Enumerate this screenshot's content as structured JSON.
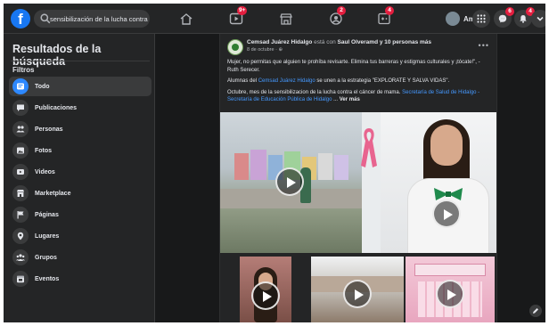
{
  "header": {
    "logo": "f",
    "search_value": "sensibilización de la lucha contra e",
    "nav": [
      {
        "name": "home-icon"
      },
      {
        "name": "watch-icon",
        "badge": "9+"
      },
      {
        "name": "marketplace-icon"
      },
      {
        "name": "groups-icon",
        "badge": "2"
      },
      {
        "name": "gaming-icon",
        "badge": "4"
      }
    ],
    "profile_name": "Ami",
    "actions": [
      {
        "name": "menu-grid-icon"
      },
      {
        "name": "messenger-icon",
        "badge": "6"
      },
      {
        "name": "notifications-bell-icon",
        "badge": "4"
      },
      {
        "name": "account-chevron-icon"
      }
    ]
  },
  "sidebar": {
    "title": "Resultados de la búsqueda",
    "filters_label": "Filtros",
    "items": [
      {
        "label": "Todo",
        "icon": "all-results-icon",
        "active": true
      },
      {
        "label": "Publicaciones",
        "icon": "posts-icon"
      },
      {
        "label": "Personas",
        "icon": "people-icon"
      },
      {
        "label": "Fotos",
        "icon": "photos-icon"
      },
      {
        "label": "Videos",
        "icon": "videos-icon"
      },
      {
        "label": "Marketplace",
        "icon": "marketplace-icon"
      },
      {
        "label": "Páginas",
        "icon": "pages-flag-icon"
      },
      {
        "label": "Lugares",
        "icon": "places-pin-icon"
      },
      {
        "label": "Grupos",
        "icon": "groups-icon"
      },
      {
        "label": "Eventos",
        "icon": "events-calendar-icon"
      }
    ]
  },
  "post": {
    "author": "Cemsad Juárez Hidalgo",
    "with_text": " está con ",
    "tagged": "Saul Olveramd",
    "and_others": " y 10 personas más",
    "date": "8 de octubre · ⊕",
    "p1": "Mujer, no permitas que alguien te prohíba revisarte. Elimina tus barreras y estigmas culturales y ¡tócate!\", - Ruth Serecer.",
    "p2_pre": "Alumnas del ",
    "p2_link": "Cemsad Juárez Hidalgo",
    "p2_post": " se unen  a la estrategia \"EXPLORATE Y SALVA VIDAS\".",
    "p3_pre": "Octubre, mes de la sensibilizacion  de la lucha contra  el cáncer de mama. ",
    "p3_link": "Secretaría de Salud de Hidalgo - Secretaría de Educación Pública de Hidalgo",
    "p3_post": " ... ",
    "see_more": "Ver más"
  },
  "colors": {
    "background": "#18191a",
    "surface": "#242526",
    "accent": "#2d88ff",
    "badge": "#e41e3f",
    "text": "#e4e6eb",
    "muted": "#b0b3b8"
  }
}
